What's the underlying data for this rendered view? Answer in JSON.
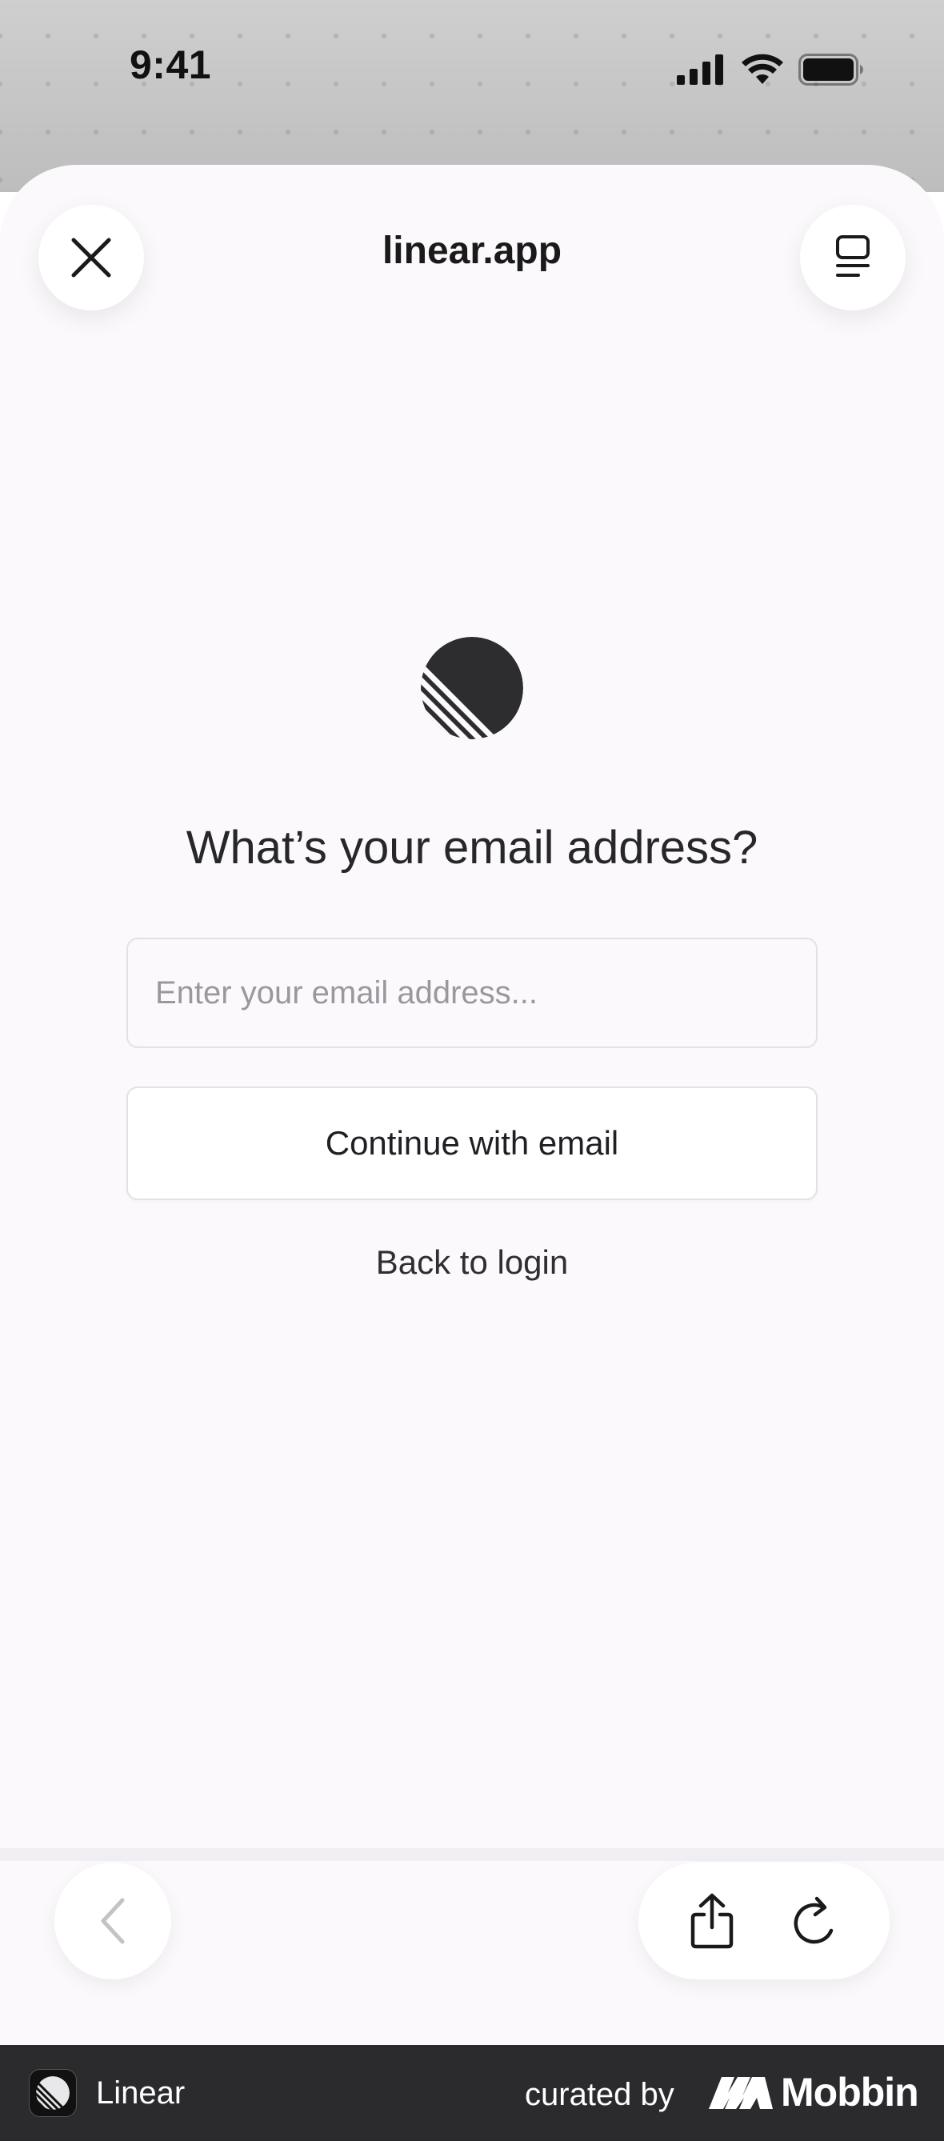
{
  "status_bar": {
    "time": "9:41",
    "icons": [
      "cellular-signal-icon",
      "wifi-icon",
      "battery-icon"
    ]
  },
  "browser": {
    "site_title": "linear.app",
    "close_icon": "close-icon",
    "tabs_icon": "tabs-icon",
    "back_icon": "chevron-left-icon",
    "share_icon": "share-icon",
    "reload_icon": "reload-icon"
  },
  "login": {
    "logo": "linear-logo",
    "heading": "What’s your email address?",
    "email_placeholder": "Enter your email address...",
    "email_value": "",
    "continue_label": "Continue with email",
    "back_label": "Back to login"
  },
  "footer": {
    "app_name": "Linear",
    "curated_label": "curated by",
    "brand": "Mobbin"
  },
  "colors": {
    "sheet_bg": "#fbf9fc",
    "text_primary": "#26262b",
    "placeholder": "#9a989e",
    "border": "#e3e1e6",
    "footer_bg": "#2b2b2e",
    "logo": "#2d2d30"
  }
}
